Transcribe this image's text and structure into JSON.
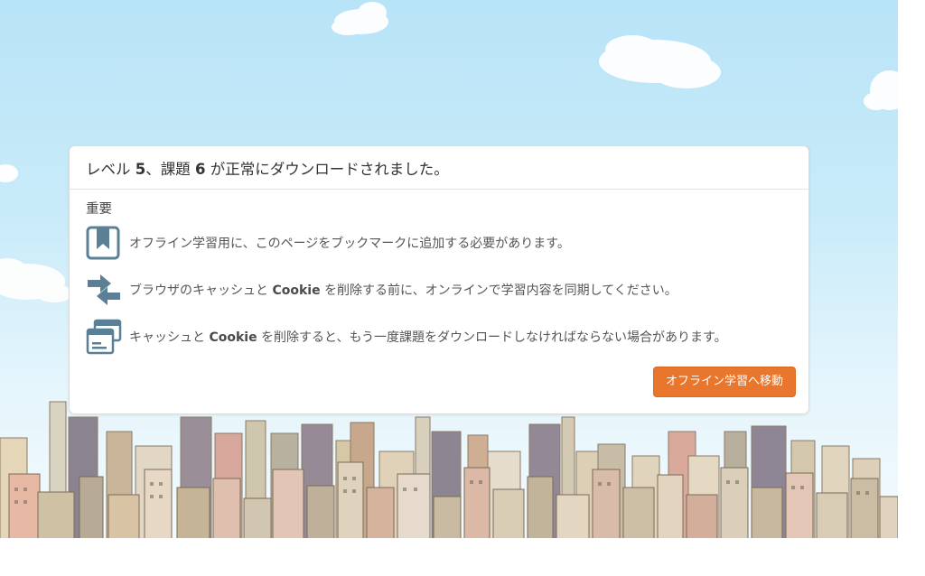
{
  "dialog": {
    "title_prefix": "レベル ",
    "title_level": "5",
    "title_mid": "、課題 ",
    "title_task": "6",
    "title_suffix": " が正常にダウンロードされました。",
    "important_label": "重要",
    "notices": [
      {
        "icon": "bookmark-icon",
        "text_a": "オフライン学習用に、このページをブックマークに追加する必要があります。",
        "text_b": "",
        "text_c": ""
      },
      {
        "icon": "sync-arrows-icon",
        "text_a": "ブラウザのキャッシュと ",
        "text_b": "Cookie",
        "text_c": " を削除する前に、オンラインで学習内容を同期してください。"
      },
      {
        "icon": "browser-windows-icon",
        "text_a": "キャッシュと ",
        "text_b": "Cookie",
        "text_c": " を削除すると、もう一度課題をダウンロードしなければならない場合があります。"
      }
    ],
    "button_label": "オフライン学習へ移動"
  },
  "colors": {
    "accent": "#e8762c",
    "icon": "#5b7f95",
    "sky": "#b8e4f7"
  }
}
